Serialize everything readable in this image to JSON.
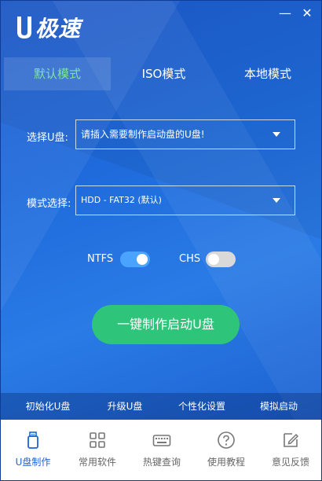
{
  "app": {
    "logo_text": "极速"
  },
  "window": {
    "minimize_label": "—",
    "close_label": "✕"
  },
  "tabs": [
    {
      "label": "默认模式",
      "active": true
    },
    {
      "label": "ISO模式",
      "active": false
    },
    {
      "label": "本地模式",
      "active": false
    }
  ],
  "form": {
    "usb_label": "选择U盘:",
    "usb_value": "请插入需要制作启动盘的U盘!",
    "mode_label": "模式选择:",
    "mode_value": "HDD - FAT32 (默认)"
  },
  "toggles": {
    "ntfs": {
      "label": "NTFS",
      "on": true
    },
    "chs": {
      "label": "CHS",
      "on": false
    }
  },
  "actions": {
    "make_button": "一键制作启动U盘"
  },
  "toolbar": {
    "init": "初始化U盘",
    "upgrade": "升级U盘",
    "personalize": "个性化设置",
    "simulate": "模拟启动"
  },
  "nav": [
    {
      "label": "U盘制作",
      "icon": "usb-icon",
      "active": true
    },
    {
      "label": "常用软件",
      "icon": "apps-icon",
      "active": false
    },
    {
      "label": "热键查询",
      "icon": "keyboard-icon",
      "active": false
    },
    {
      "label": "使用教程",
      "icon": "help-icon",
      "active": false
    },
    {
      "label": "意见反馈",
      "icon": "edit-icon",
      "active": false
    }
  ],
  "colors": {
    "accent_green": "#2ec47a",
    "active_tab_text": "#7fe3a3",
    "toggle_on": "#4aa3ff",
    "nav_active": "#1b64d8",
    "background_blue": "#1f6bdc"
  }
}
